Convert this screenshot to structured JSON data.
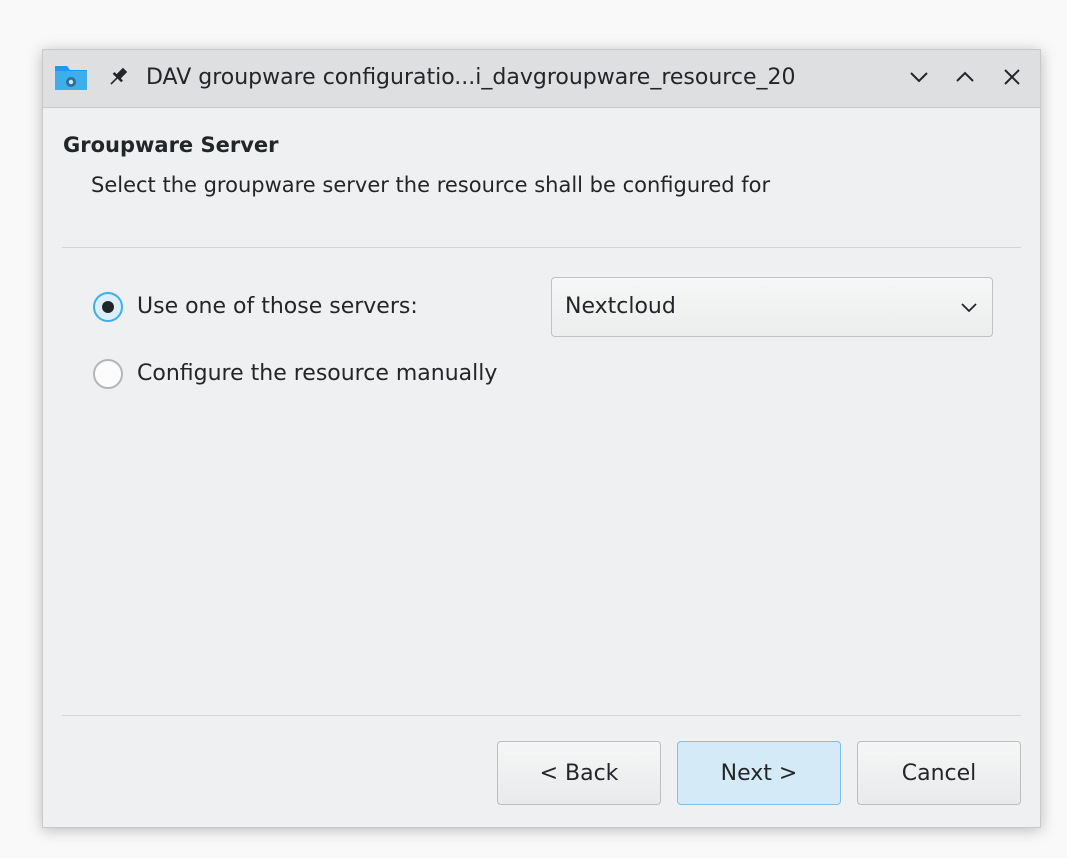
{
  "window": {
    "title": "DAV groupware configuratio...i_davgroupware_resource_20"
  },
  "page": {
    "heading": "Groupware Server",
    "subheading": "Select the groupware server the resource shall be configured for"
  },
  "options": {
    "use_server_label": "Use one of those servers:",
    "use_server_checked": true,
    "manual_label": "Configure the resource manually",
    "manual_checked": false
  },
  "server_select": {
    "value": "Nextcloud"
  },
  "buttons": {
    "back": "< Back",
    "next": "Next >",
    "cancel": "Cancel"
  },
  "colors": {
    "accent": "#3daee9",
    "window_bg": "#eff0f1",
    "text": "#232629"
  },
  "icons": {
    "app": "folder-dav-icon",
    "pin": "pin-icon",
    "minimize": "chevron-down-icon",
    "maximize": "chevron-up-icon",
    "close": "close-icon",
    "combo": "chevron-down-icon"
  }
}
